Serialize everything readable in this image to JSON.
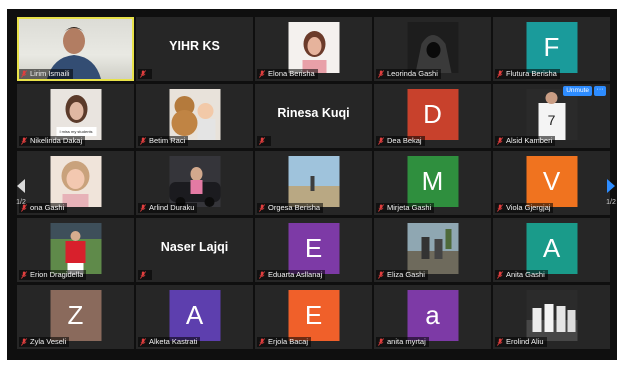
{
  "pager": {
    "left_page": "1/2",
    "right_page": "1/2"
  },
  "tile_controls": {
    "unmute_label": "Unmute",
    "more_label": "···"
  },
  "participants": [
    {
      "name": "Lirim Ismaili",
      "type": "video",
      "active": true
    },
    {
      "name": "",
      "display": "YIHR KS",
      "type": "text"
    },
    {
      "name": "Elona Berisha",
      "type": "photo",
      "photo": "portrait-light"
    },
    {
      "name": "Leorinda Gashi",
      "type": "photo",
      "photo": "hooded-dark"
    },
    {
      "name": "Flutura Berisha",
      "letter": "F",
      "color": "#1a9b9b",
      "type": "letter"
    },
    {
      "name": "Nikelinda Dakaj",
      "type": "photo",
      "photo": "selfie-caption",
      "caption": "I miss my students"
    },
    {
      "name": "Betim Raci",
      "type": "photo",
      "photo": "teddy-baby"
    },
    {
      "name": "",
      "display": "Rinesa Kuqi",
      "type": "text"
    },
    {
      "name": "Dea Bekaj",
      "letter": "D",
      "color": "#c8412c",
      "type": "letter"
    },
    {
      "name": "Alsid Kamberi",
      "type": "photo",
      "photo": "jersey-7",
      "controls": true
    },
    {
      "name": "ona Gashi",
      "type": "photo",
      "photo": "child-portrait"
    },
    {
      "name": "Arlind Duraku",
      "type": "photo",
      "photo": "car-portrait"
    },
    {
      "name": "Orgesa Berisha",
      "type": "photo",
      "photo": "landscape"
    },
    {
      "name": "Mirjeta Gashi",
      "letter": "M",
      "color": "#2f8f3e",
      "type": "letter"
    },
    {
      "name": "Viola Gjergjaj",
      "letter": "V",
      "color": "#f0731f",
      "type": "letter"
    },
    {
      "name": "Erion Dragidella",
      "type": "photo",
      "photo": "football-red"
    },
    {
      "name": "",
      "display": "Naser Lajqi",
      "type": "text"
    },
    {
      "name": "Eduarta Asllanaj",
      "letter": "E",
      "color": "#7d3aa6",
      "type": "letter"
    },
    {
      "name": "Eliza Gashi",
      "type": "photo",
      "photo": "outdoor-street"
    },
    {
      "name": "Anita Gashi",
      "letter": "A",
      "color": "#1a9b8a",
      "type": "letter"
    },
    {
      "name": "Zyla Veseli",
      "letter": "Z",
      "color": "#8a6a5c",
      "type": "letter"
    },
    {
      "name": "Alketa Kastrati",
      "letter": "A",
      "color": "#5d3fae",
      "type": "letter"
    },
    {
      "name": "Erjola Bacaj",
      "letter": "E",
      "color": "#f0602a",
      "type": "letter"
    },
    {
      "name": "anita myrtaj",
      "letter": "a",
      "color": "#7d3aa6",
      "type": "letter"
    },
    {
      "name": "Erolind Aliu",
      "type": "photo",
      "photo": "team-photo"
    }
  ]
}
